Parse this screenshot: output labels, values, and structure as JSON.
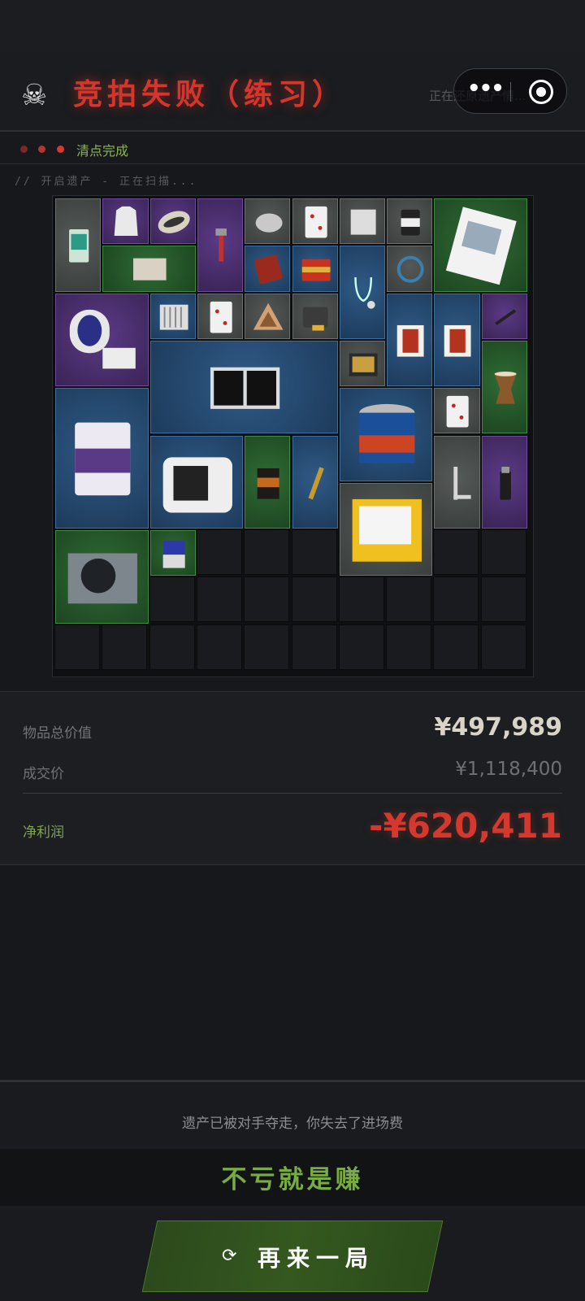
{
  "header": {
    "skull_icon": "skull-icon",
    "title": "竞拍失败（练习）",
    "restoring_text": "正在还原遗产情...",
    "capsule": {
      "more_icon": "more-dots-icon",
      "target_icon": "close-target-icon"
    }
  },
  "status": {
    "text": "清点完成",
    "dot_colors": [
      "#7a2a26",
      "#b8332b",
      "#d8392f"
    ]
  },
  "scan_text": "// 开启遗产 - 正在扫描...",
  "grid": {
    "columns": 10,
    "rows": 10,
    "items": [
      {
        "name": "toothpaste",
        "rarity": "gray"
      },
      {
        "name": "vest",
        "rarity": "purple"
      },
      {
        "name": "rugby-ball",
        "rarity": "purple"
      },
      {
        "name": "pipe-wrench",
        "rarity": "purple"
      },
      {
        "name": "mouse",
        "rarity": "gray"
      },
      {
        "name": "playing-card",
        "rarity": "gray"
      },
      {
        "name": "paper-bag",
        "rarity": "gray"
      },
      {
        "name": "protein-jar",
        "rarity": "gray"
      },
      {
        "name": "comic-book",
        "rarity": "green"
      },
      {
        "name": "wood-plank",
        "rarity": "green"
      },
      {
        "name": "red-pouch",
        "rarity": "blue"
      },
      {
        "name": "tea-tin",
        "rarity": "blue"
      },
      {
        "name": "stethoscope",
        "rarity": "blue"
      },
      {
        "name": "cable",
        "rarity": "gray"
      },
      {
        "name": "blood-pressure-monitor",
        "rarity": "purple"
      },
      {
        "name": "radiator",
        "rarity": "blue"
      },
      {
        "name": "playing-card-2",
        "rarity": "gray"
      },
      {
        "name": "triangle-badge",
        "rarity": "gray"
      },
      {
        "name": "tape-measure",
        "rarity": "gray"
      },
      {
        "name": "poster-card",
        "rarity": "blue"
      },
      {
        "name": "poster-card-2",
        "rarity": "blue"
      },
      {
        "name": "airbrush",
        "rarity": "purple"
      },
      {
        "name": "solar-panel",
        "rarity": "blue"
      },
      {
        "name": "tool-case",
        "rarity": "gray"
      },
      {
        "name": "djembe-drum",
        "rarity": "green"
      },
      {
        "name": "cement-bag",
        "rarity": "blue"
      },
      {
        "name": "paint-bucket",
        "rarity": "blue"
      },
      {
        "name": "card-3",
        "rarity": "gray"
      },
      {
        "name": "printer",
        "rarity": "blue"
      },
      {
        "name": "coffee-bag",
        "rarity": "green"
      },
      {
        "name": "spyglass",
        "rarity": "blue"
      },
      {
        "name": "square-ruler",
        "rarity": "gray"
      },
      {
        "name": "torch-canister",
        "rarity": "purple"
      },
      {
        "name": "candle-box",
        "rarity": "gray"
      },
      {
        "name": "power-supply",
        "rarity": "green"
      },
      {
        "name": "battery",
        "rarity": "green"
      }
    ]
  },
  "summary": {
    "total_label": "物品总价值",
    "total_value": "¥497,989",
    "deal_label": "成交价",
    "deal_value": "¥1,118,400",
    "profit_label": "净利润",
    "profit_value": "-¥620,411"
  },
  "footer": {
    "message": "遗产已被对手夺走，你失去了进场费",
    "motto": "不亏就是赚",
    "replay_icon": "refresh-icon",
    "replay_label": "再来一局"
  },
  "colors": {
    "accent_red": "#d5362c",
    "accent_green": "#7fa64a",
    "rarity_purple": "#5b3a86",
    "rarity_blue": "#2f5a86",
    "rarity_green": "#2f6b34",
    "rarity_gray": "#555a58"
  }
}
